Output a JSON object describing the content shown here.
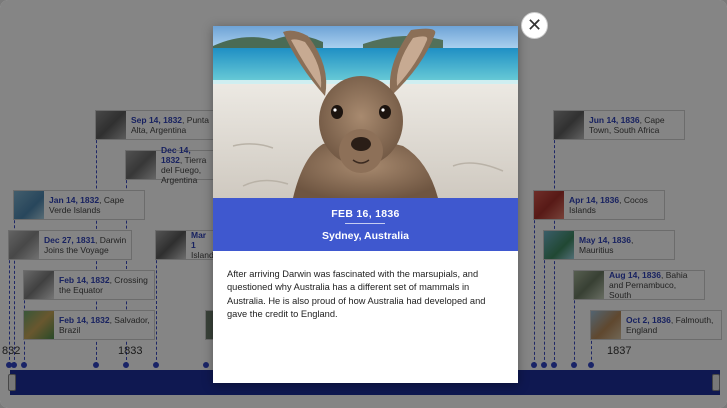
{
  "timeline": {
    "events": [
      {
        "date": "Sep 14, 1832",
        "text": "Punta Alta, Argentina"
      },
      {
        "date": "Dec 14, 1832",
        "text": "Tierra del Fuego, Argentina"
      },
      {
        "date": "Jan 14, 1832",
        "text": "Cape Verde Islands"
      },
      {
        "date": "Dec 27, 1831",
        "text": "Darwin Joins the Voyage"
      },
      {
        "date": "Mar 1",
        "text": "Island"
      },
      {
        "date": "Feb 14, 1832",
        "text": "Crossing the Equator"
      },
      {
        "date": "Feb 14, 1832",
        "text": "Salvador, Brazil"
      },
      {
        "date": "Jun 14, 1836",
        "text": "Cape Town, South Africa"
      },
      {
        "date": "Apr 14, 1836",
        "text": "Cocos Islands"
      },
      {
        "date": "May 14, 1836",
        "text": "Mauritius"
      },
      {
        "date": "Aug 14, 1836",
        "text": "Bahia and Pernambuco, South"
      },
      {
        "date": "Oct 2, 1836",
        "text": "Falmouth, England"
      }
    ],
    "year_labels": [
      "832",
      "1833",
      "1837"
    ],
    "colors": {
      "bar": "#1e2f9c",
      "accent": "#2f41b8"
    }
  },
  "modal": {
    "photo_icon": "kangaroo-photo",
    "date": "FEB 16, 1836",
    "location": "Sydney, Australia",
    "description": "After arriving Darwin was fascinated with the marsupials, and questioned why Australia has a different set of mammals in Australia. He is also proud of how Australia had developed and gave the credit to England.",
    "banner_color": "#3f58cf",
    "close_icon": "close-icon",
    "close_glyph": "✕"
  }
}
